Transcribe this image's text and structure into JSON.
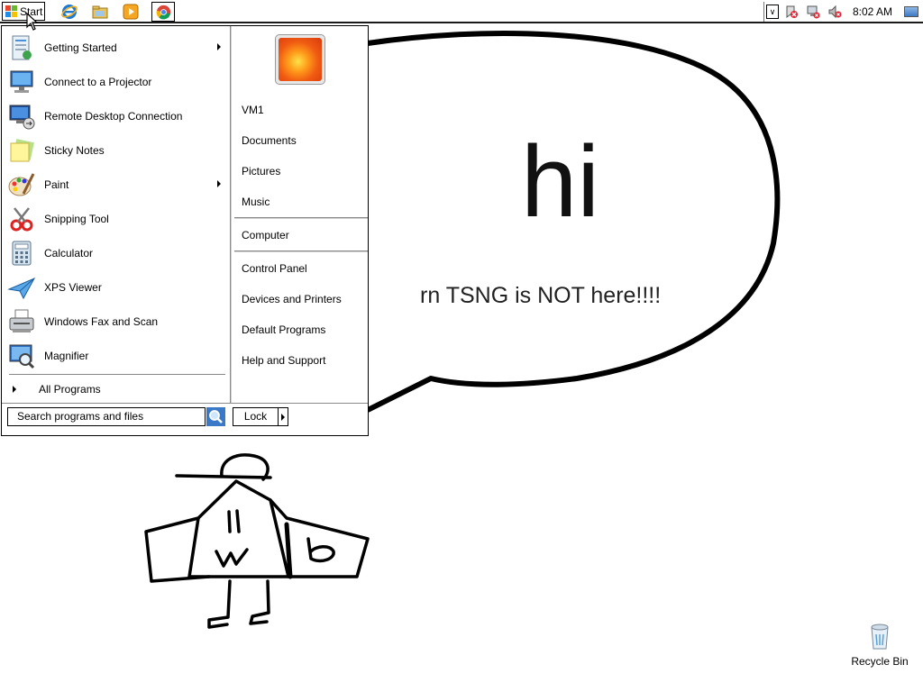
{
  "taskbar": {
    "start_label": "Start",
    "pinned": [
      "internet-explorer-icon",
      "windows-explorer-icon",
      "media-player-icon",
      "chrome-icon"
    ],
    "clock": "8:02 AM"
  },
  "desktop": {
    "drawing_text": {
      "big": "hi",
      "small": "rn TSNG is NOT here!!!!"
    },
    "recycle_bin_label": "Recycle Bin"
  },
  "start_menu": {
    "programs": [
      {
        "label": "Getting Started",
        "icon": "getting-started-icon",
        "submenu": true
      },
      {
        "label": "Connect to a Projector",
        "icon": "projector-icon",
        "submenu": false
      },
      {
        "label": "Remote Desktop Connection",
        "icon": "remote-desktop-icon",
        "submenu": false
      },
      {
        "label": "Sticky Notes",
        "icon": "sticky-notes-icon",
        "submenu": false
      },
      {
        "label": "Paint",
        "icon": "paint-icon",
        "submenu": true
      },
      {
        "label": "Snipping Tool",
        "icon": "snipping-tool-icon",
        "submenu": false
      },
      {
        "label": "Calculator",
        "icon": "calculator-icon",
        "submenu": false
      },
      {
        "label": "XPS Viewer",
        "icon": "xps-viewer-icon",
        "submenu": false
      },
      {
        "label": "Windows Fax and Scan",
        "icon": "fax-scan-icon",
        "submenu": false
      },
      {
        "label": "Magnifier",
        "icon": "magnifier-icon",
        "submenu": false
      }
    ],
    "all_programs": "All Programs",
    "search_placeholder": "Search programs and files",
    "right": {
      "user": "VM1",
      "group1": [
        "Documents",
        "Pictures",
        "Music"
      ],
      "group2": [
        "Computer"
      ],
      "group3": [
        "Control Panel",
        "Devices and Printers",
        "Default Programs",
        "Help and Support"
      ]
    },
    "lock_label": "Lock"
  }
}
